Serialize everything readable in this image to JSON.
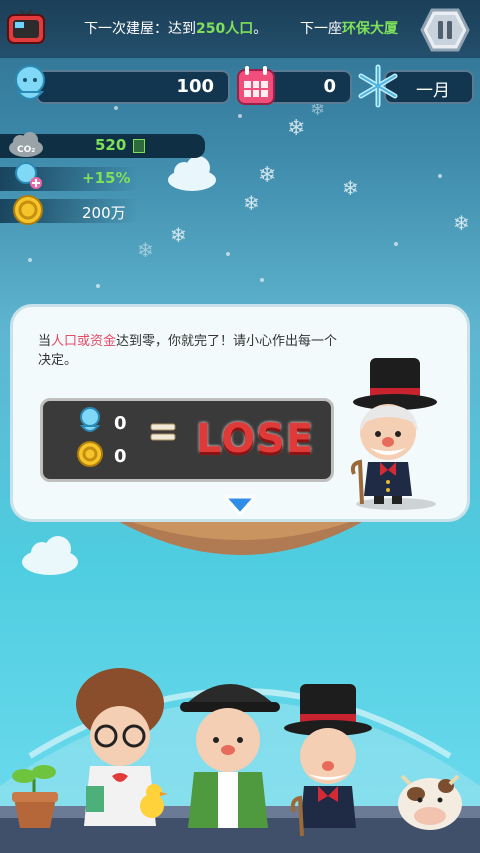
{
  "top_bar": {
    "next_build_prefix": "下一次建屋：达到",
    "next_build_value": "250人口",
    "next_build_suffix": "。",
    "next_tower_prefix": "下一座",
    "next_tower_value": "环保大厦"
  },
  "stats": {
    "population": "100",
    "days": "0",
    "month": "一月",
    "co2": "520",
    "happiness": "+15%",
    "money": "200万"
  },
  "dialog": {
    "text_prefix": "当",
    "text_red": "人口或资金",
    "text_suffix": "达到零，你就完了！请小心作出每一个决定。",
    "lose_population": "0",
    "lose_money": "0",
    "lose_label": "LOSE"
  },
  "colors": {
    "accent_green": "#7fe05a",
    "warning_red": "#e64b66",
    "lose_red": "#e03a38"
  },
  "icons": [
    "tv-icon",
    "pause-icon",
    "population-icon",
    "calendar-icon",
    "snowflake-icon",
    "co2-icon",
    "happiness-icon",
    "coin-icon",
    "down-arrow-icon"
  ]
}
